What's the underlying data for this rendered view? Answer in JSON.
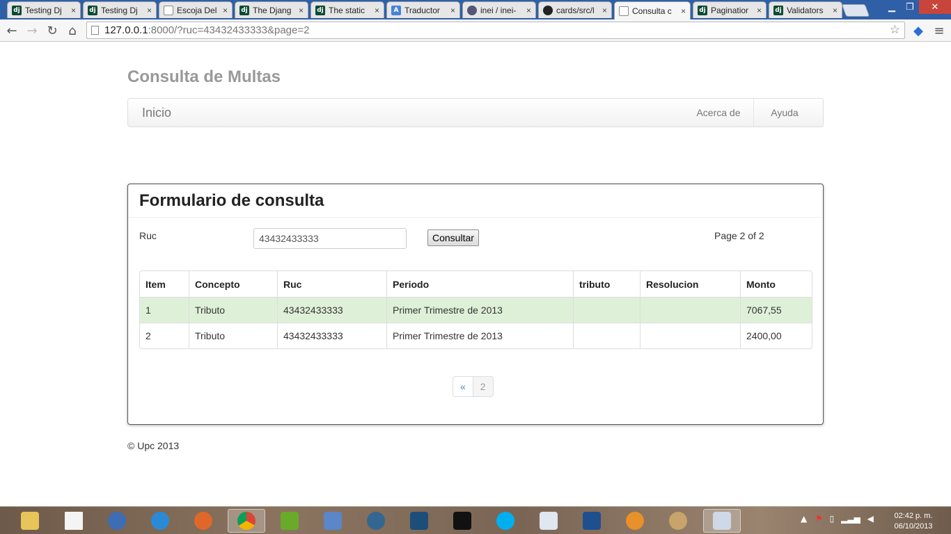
{
  "browser": {
    "tabs": [
      {
        "title": "Testing Dj",
        "icon": "django-icon"
      },
      {
        "title": "Testing Dj",
        "icon": "django-icon"
      },
      {
        "title": "Escoja Del",
        "icon": "page-icon"
      },
      {
        "title": "The Djang",
        "icon": "django-icon"
      },
      {
        "title": "The static",
        "icon": "django-icon"
      },
      {
        "title": "Traductor",
        "icon": "translate-icon"
      },
      {
        "title": "inei / inei-",
        "icon": "inei-icon"
      },
      {
        "title": "cards/src/l",
        "icon": "github-icon"
      },
      {
        "title": "Consulta c",
        "icon": "page-icon",
        "active": true
      },
      {
        "title": "Paginatior",
        "icon": "django-icon"
      },
      {
        "title": "Validators",
        "icon": "django-icon"
      }
    ],
    "tab_close": "×",
    "url_host": "127.0.0.1",
    "url_rest": ":8000/?ruc=43432433333&page=2"
  },
  "site": {
    "title": "Consulta de Multas",
    "nav": {
      "brand": "Inicio",
      "links": [
        "Acerca de",
        "Ayuda"
      ]
    }
  },
  "form": {
    "heading": "Formulario de consulta",
    "ruc_label": "Ruc",
    "ruc_value": "43432433333",
    "submit_label": "Consultar",
    "page_info": "Page 2 of 2"
  },
  "table": {
    "headers": [
      "Item",
      "Concepto",
      "Ruc",
      "Periodo",
      "tributo",
      "Resolucion",
      "Monto"
    ],
    "rows": [
      [
        "1",
        "Tributo",
        "43432433333",
        "Primer Trimestre de 2013",
        "",
        "",
        "7067,55"
      ],
      [
        "2",
        "Tributo",
        "43432433333",
        "Primer Trimestre de 2013",
        "",
        "",
        "2400,00"
      ]
    ]
  },
  "pagination": {
    "prev": "«",
    "current": "2"
  },
  "footer": "© Upc 2013",
  "taskbar": {
    "clock_time": "02:42 p. m.",
    "clock_date": "06/10/2013"
  },
  "colors": {
    "tabstrip": "#2f5fa6",
    "row_success": "#dff0d8",
    "link": "#428bca"
  }
}
